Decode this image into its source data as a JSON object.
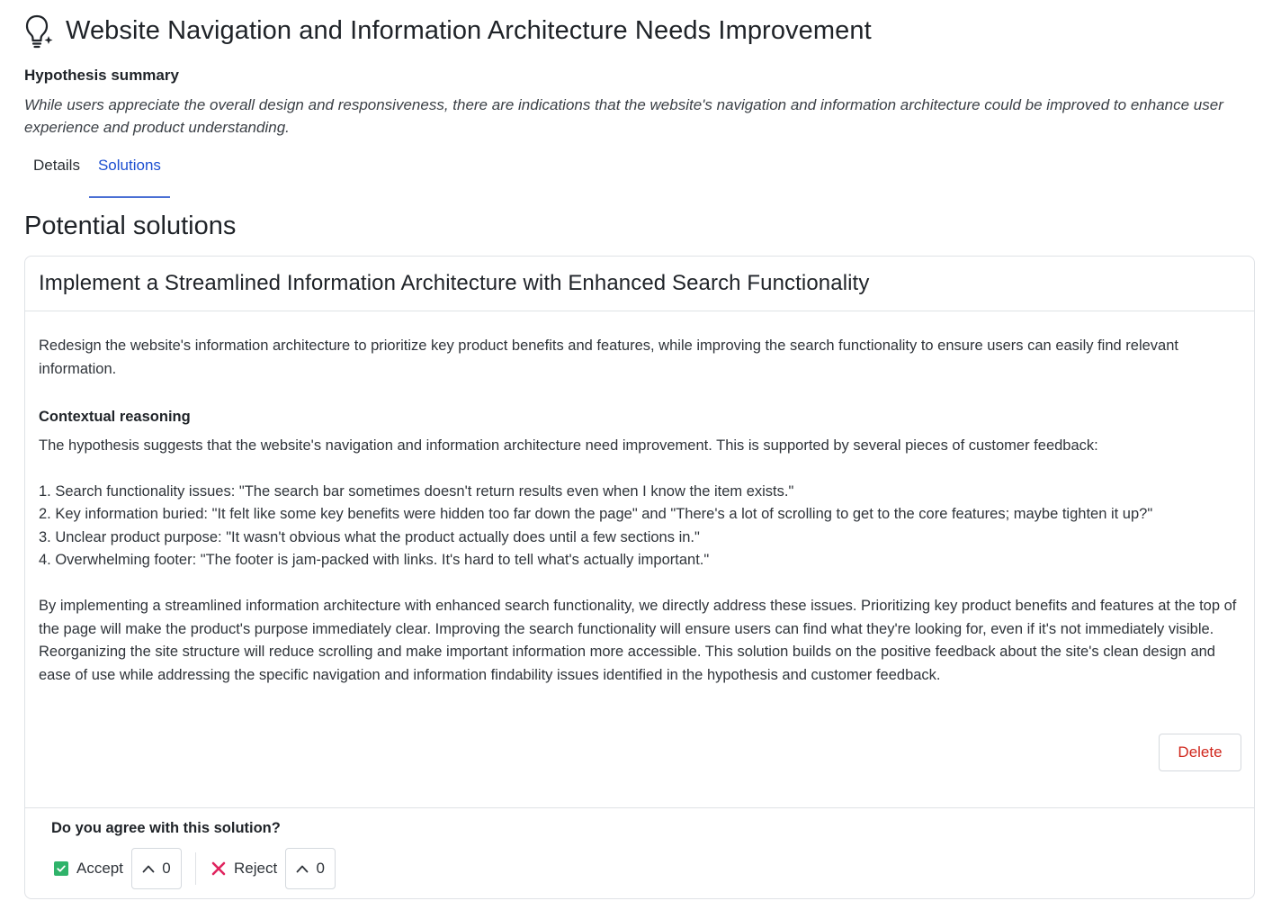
{
  "header": {
    "title": "Website Navigation and Information Architecture Needs Improvement",
    "icon": "lightbulb-sparkle-icon"
  },
  "summary": {
    "label": "Hypothesis summary",
    "text": "While users appreciate the overall design and responsiveness, there are indications that the website's navigation and information architecture could be improved to enhance user experience and product understanding."
  },
  "tabs": [
    {
      "label": "Details",
      "active": false
    },
    {
      "label": "Solutions",
      "active": true
    }
  ],
  "section_title": "Potential solutions",
  "solution": {
    "title": "Implement a Streamlined Information Architecture with Enhanced Search Functionality",
    "description": "Redesign the website's information architecture to prioritize key product benefits and features, while improving the search functionality to ensure users can easily find relevant information.",
    "reasoning_label": "Contextual reasoning",
    "reasoning_text": "The hypothesis suggests that the website's navigation and information architecture need improvement. This is supported by several pieces of customer feedback:\n\n1. Search functionality issues: \"The search bar sometimes doesn't return results even when I know the item exists.\"\n2. Key information buried: \"It felt like some key benefits were hidden too far down the page\" and \"There's a lot of scrolling to get to the core features; maybe tighten it up?\"\n3. Unclear product purpose: \"It wasn't obvious what the product actually does until a few sections in.\"\n4. Overwhelming footer: \"The footer is jam-packed with links. It's hard to tell what's actually important.\"\n\nBy implementing a streamlined information architecture with enhanced search functionality, we directly address these issues. Prioritizing key product benefits and features at the top of the page will make the product's purpose immediately clear. Improving the search functionality will ensure users can find what they're looking for, even if it's not immediately visible. Reorganizing the site structure will reduce scrolling and make important information more accessible. This solution builds on the positive feedback about the site's clean design and ease of use while addressing the specific navigation and information findability issues identified in the hypothesis and customer feedback.",
    "delete_label": "Delete"
  },
  "feedback": {
    "question": "Do you agree with this solution?",
    "accept_label": "Accept",
    "accept_count": "0",
    "reject_label": "Reject",
    "reject_count": "0"
  },
  "colors": {
    "accent": "#1c4fd1",
    "accept": "#2fb36a",
    "reject": "#e0245e",
    "delete": "#d0271d"
  }
}
